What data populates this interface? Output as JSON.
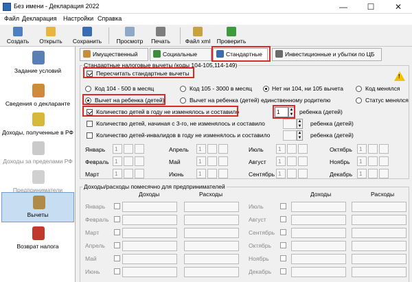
{
  "window": {
    "title": "Без имени - Декларация 2022",
    "minimize": "—",
    "maximize": "☐",
    "close": "✕"
  },
  "menu": [
    "Файл",
    "Декларация",
    "Настройки",
    "Справка"
  ],
  "toolbar": [
    {
      "label": "Создать",
      "icon": "new-icon",
      "color": "#4f7fc0"
    },
    {
      "label": "Открыть",
      "icon": "open-icon",
      "color": "#e8b640"
    },
    {
      "label": "Сохранить",
      "icon": "save-icon",
      "color": "#3a6bb3"
    },
    {
      "label": "Просмотр",
      "icon": "preview-icon",
      "color": "#8fa8c8"
    },
    {
      "label": "Печать",
      "icon": "print-icon",
      "color": "#7d7d7d"
    },
    {
      "label": "Файл xml",
      "icon": "xml-file-icon",
      "color": "#c8a240"
    },
    {
      "label": "Проверить",
      "icon": "check-icon",
      "color": "#3e9a3e"
    }
  ],
  "sidebar": [
    {
      "label": "Задание условий",
      "icon": "settings-icon",
      "color": "#5a7fb5",
      "state": "normal"
    },
    {
      "label": "Сведения о декларанте",
      "icon": "person-icon",
      "color": "#d08a3c",
      "state": "normal"
    },
    {
      "label": "Доходы, полученные в РФ",
      "icon": "coins-icon",
      "color": "#d8b838",
      "state": "normal"
    },
    {
      "label": "Доходы за пределами РФ",
      "icon": "money-bag-icon",
      "color": "#7a7a7a",
      "state": "disabled"
    },
    {
      "label": "Предприниматели",
      "icon": "business-icon",
      "color": "#8a8a8a",
      "state": "disabled"
    },
    {
      "label": "Вычеты",
      "icon": "deductions-icon",
      "color": "#b08a4a",
      "state": "active"
    },
    {
      "label": "Возврат налога",
      "icon": "refund-icon",
      "color": "#c0392b",
      "state": "normal"
    }
  ],
  "tabs": [
    {
      "label": "Имущественный",
      "icon": "house-icon",
      "color": "#c78d3a"
    },
    {
      "label": "Социальные",
      "icon": "social-icon",
      "color": "#3c8d3c"
    },
    {
      "label": "Стандартные",
      "icon": "standard-icon",
      "color": "#3a6bb3"
    },
    {
      "label": "Инвестиционные и убытки по ЦБ",
      "icon": "invest-icon",
      "color": "#6b6b6b"
    }
  ],
  "standard": {
    "group_title": "Стандартные налоговые вычеты (коды 104-105,114-149)",
    "recalc_label": "Пересчитать стандартные вычеты",
    "codes": [
      "Код 104 - 500 в месяц",
      "Код 105 - 3000 в месяц",
      "Нет ни 104, ни 105 вычета",
      "Код менялся"
    ],
    "child_options": [
      "Вычет на ребенка (детей)",
      "Вычет на ребенка (детей) единственному родителю",
      "Статус менялся"
    ],
    "kids": [
      {
        "label": "Количество детей в году не изменялось и составило",
        "value": "1",
        "suffix": "ребенка (детей)"
      },
      {
        "label": "Количество детей, начиная с 3-го, не изменялось и составило",
        "value": "",
        "suffix": "ребенка (детей)"
      },
      {
        "label": "Количество детей-инвалидов в году не изменялось и составило",
        "value": "",
        "suffix": "ребенка (детей)"
      }
    ],
    "months": [
      [
        "Январь",
        "Апрель",
        "Июль",
        "Октябрь"
      ],
      [
        "Февраль",
        "Май",
        "Август",
        "Ноябрь"
      ],
      [
        "Март",
        "Июнь",
        "Сентябрь",
        "Декабрь"
      ]
    ],
    "month_value": "1"
  },
  "business": {
    "group_title": "Доходы/расходы помесячно для предпринимателей",
    "col_income": "Доходы",
    "col_expense": "Расходы",
    "months_left": [
      "Январь",
      "Февраль",
      "Март",
      "Апрель",
      "Май",
      "Июнь"
    ],
    "months_right": [
      "Июль",
      "Август",
      "Сентябрь",
      "Октябрь",
      "Ноябрь",
      "Декабрь"
    ]
  },
  "warning_icon": "warning-icon"
}
